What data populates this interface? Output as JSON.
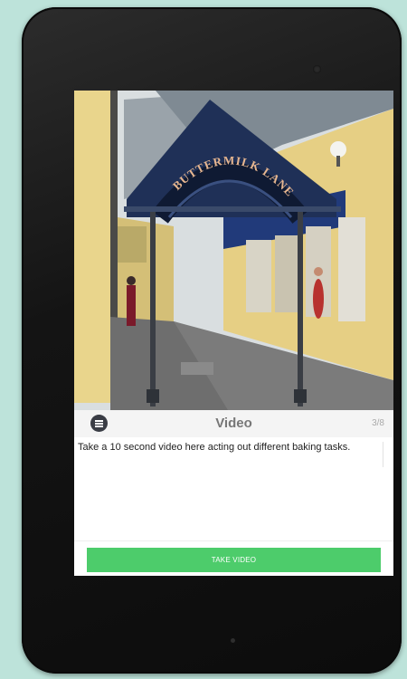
{
  "photo": {
    "sign_text": "BUTTERMILK LANE"
  },
  "header": {
    "title": "Video",
    "counter": "3/8",
    "icon": "list-icon"
  },
  "task": {
    "description": "Take a 10 second video here acting out different baking tasks."
  },
  "actions": {
    "take_video_label": "TAKE VIDEO"
  },
  "colors": {
    "accent_green": "#4dcc6b",
    "background": "#bde3da",
    "device_body": "#141414"
  }
}
